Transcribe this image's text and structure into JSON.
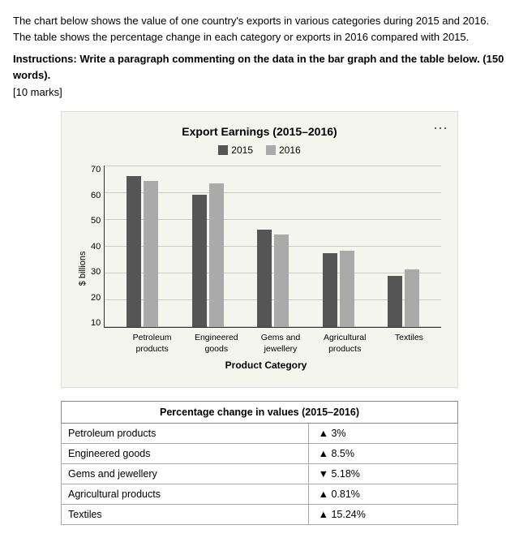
{
  "intro": {
    "text": "The chart below shows the value of one country's exports in various categories during 2015 and 2016. The table shows the percentage change in each category or exports in 2016 compared with 2015.",
    "instructions": "Instructions: Write a paragraph commenting on the data in the bar graph and the table below. (150 words).",
    "marks": "[10 marks]"
  },
  "chart": {
    "title": "Export Earnings (2015–2016)",
    "legend": {
      "year2015": "2015",
      "year2016": "2016"
    },
    "yAxisLabel": "$ billions",
    "yTicks": [
      "10",
      "20",
      "30",
      "40",
      "50",
      "60",
      "70"
    ],
    "maxValue": 70,
    "xAxisTitle": "Product Category",
    "categories": [
      {
        "name": "Petroleum\nproducts",
        "label_line1": "Petroleum",
        "label_line2": "products",
        "val2015": 65,
        "val2016": 63,
        "color2015": "#666",
        "color2016": "#999"
      },
      {
        "name": "Engineered\ngoods",
        "label_line1": "Engineered",
        "label_line2": "goods",
        "val2015": 57,
        "val2016": 62,
        "color2015": "#666",
        "color2016": "#999"
      },
      {
        "name": "Gems and\njewellery",
        "label_line1": "Gems and",
        "label_line2": "jewellery",
        "val2015": 42,
        "val2016": 40,
        "color2015": "#666",
        "color2016": "#999"
      },
      {
        "name": "Agricultural\nproducts",
        "label_line1": "Agricultural",
        "label_line2": "products",
        "val2015": 32,
        "val2016": 33,
        "color2015": "#444",
        "color2016": "#999"
      },
      {
        "name": "Textiles",
        "label_line1": "Textiles",
        "label_line2": "",
        "val2015": 22,
        "val2016": 25,
        "color2015": "#444",
        "color2016": "#999"
      }
    ]
  },
  "table": {
    "header": "Percentage change in values (2015–2016)",
    "rows": [
      {
        "category": "Petroleum products",
        "direction": "up",
        "value": "3%"
      },
      {
        "category": "Engineered goods",
        "direction": "up",
        "value": "8.5%"
      },
      {
        "category": "Gems and jewellery",
        "direction": "down",
        "value": "5.18%"
      },
      {
        "category": "Agricultural products",
        "direction": "up",
        "value": "0.81%"
      },
      {
        "category": "Textiles",
        "direction": "up",
        "value": "15.24%"
      }
    ]
  },
  "colors": {
    "bar2015": "#555",
    "bar2016": "#aaa",
    "legend2015": "#555",
    "legend2016": "#aaa"
  }
}
